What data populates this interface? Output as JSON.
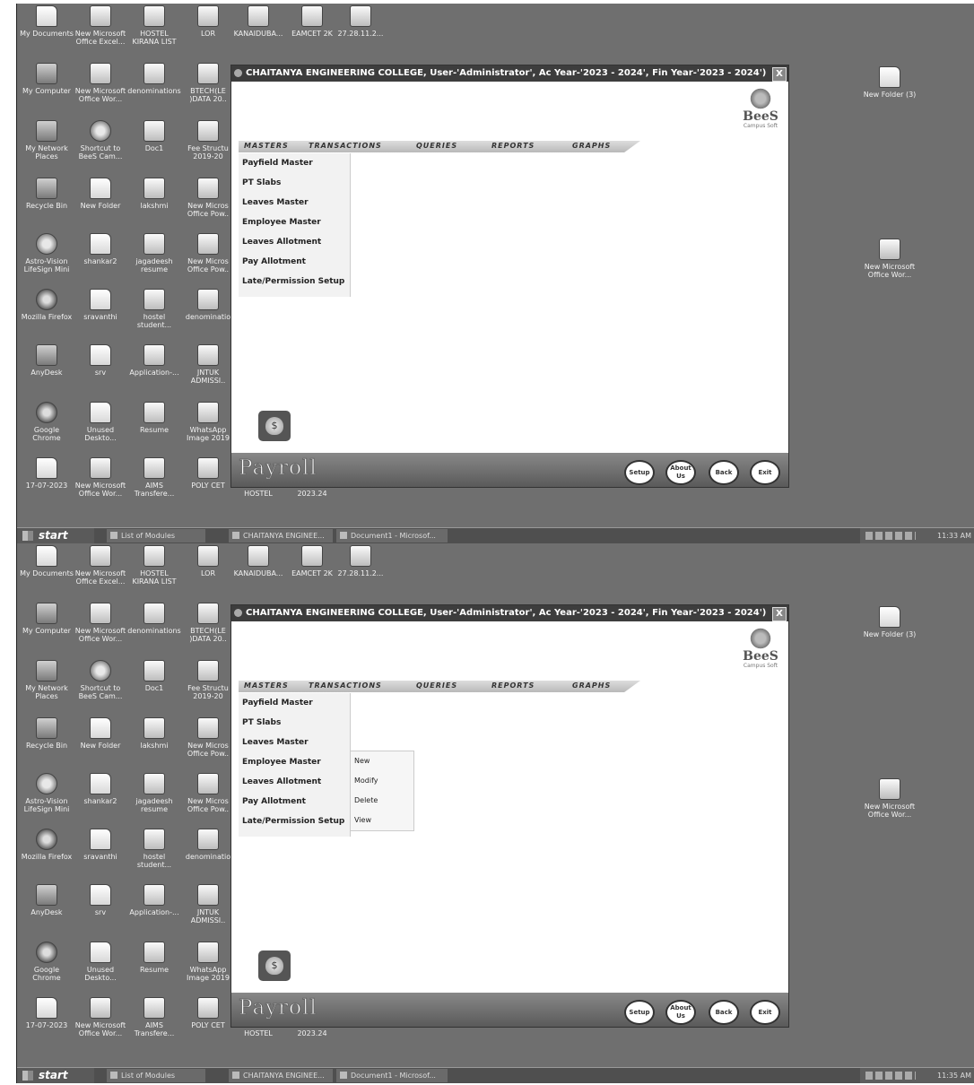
{
  "desktop": {
    "left_icons": [
      [
        "My Documents",
        "New Microsoft Office Excel...",
        "HOSTEL KIRANA LIST",
        "LOR",
        "KANAIDUBA...",
        "EAMCET 2K",
        "27.28.11.2..."
      ],
      [
        "My Computer",
        "New Microsoft Office Wor...",
        "denominations",
        "BTECH(LE )DATA 20.."
      ],
      [
        "My Network Places",
        "Shortcut to BeeS Cam...",
        "Doc1",
        "Fee Structu 2019-20"
      ],
      [
        "Recycle Bin",
        "New Folder",
        "lakshmi",
        "New Micros Office Pow.."
      ],
      [
        "Astro-Vision LifeSign Mini",
        "shankar2",
        "jagadeesh resume",
        "New Micros Office Pow.."
      ],
      [
        "Mozilla Firefox",
        "sravanthi",
        "hostel student...",
        "denominatio"
      ],
      [
        "AnyDesk",
        "srv",
        "Application-...",
        "JNTUK ADMISSI.."
      ],
      [
        "Google Chrome",
        "Unused Deskto...",
        "Resume",
        "WhatsApp Image 2019"
      ],
      [
        "17-07-2023",
        "New Microsoft Office Wor...",
        "AIMS Transfere...",
        "POLY CET",
        "BUS FEE & HOSTEL",
        "CEC B.TECH LE 2023.24"
      ]
    ],
    "right_icons": [
      "New Folder (3)",
      "New Microsoft Office Wor..."
    ]
  },
  "window": {
    "title": "CHAITANYA ENGINEERING COLLEGE, User-'Administrator', Ac Year-'2023 - 2024', Fin Year-'2023 - 2024')",
    "close": "X",
    "logo_text": "BeeS",
    "logo_sub": "Campus Soft",
    "menu": [
      "MASTERS",
      "TRANSACTIONS",
      "QUERIES",
      "REPORTS",
      "GRAPHS"
    ],
    "masters_items": [
      "Payfield Master",
      "PT Slabs",
      "Leaves Master",
      "Employee Master",
      "Leaves Allotment",
      "Pay Allotment",
      "Late/Permission Setup"
    ],
    "employee_submenu": [
      "New",
      "Modify",
      "Delete",
      "View"
    ],
    "brand": "Payroll",
    "moneybag_symbol": "$",
    "buttons": {
      "setup": "Setup",
      "about": "About Us",
      "back": "Back",
      "exit": "Exit"
    }
  },
  "taskbar": {
    "start": "start",
    "tasks": [
      "List of Modules",
      "CHAITANYA ENGINEE...",
      "Document1 - Microsof..."
    ],
    "clock_1": "11:33 AM",
    "clock_2": "11:35 AM"
  }
}
